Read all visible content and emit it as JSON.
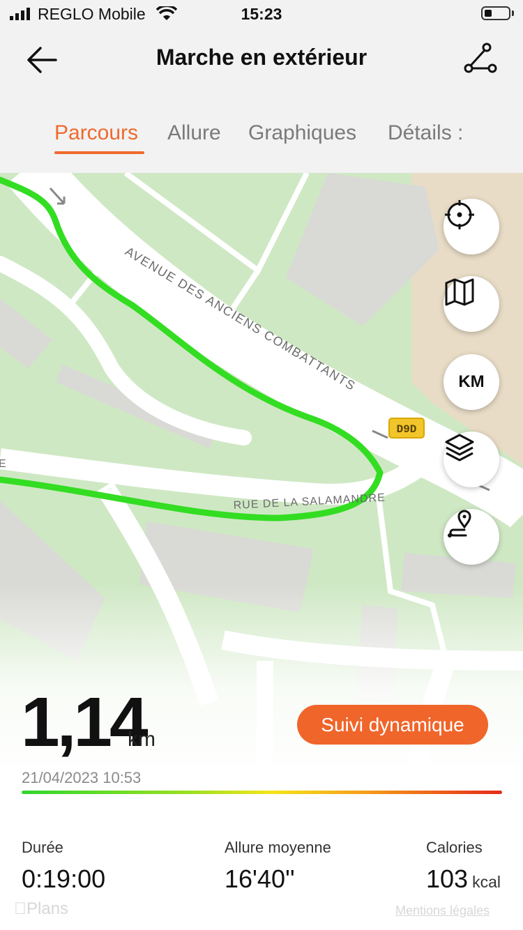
{
  "status_bar": {
    "carrier": "REGLO Mobile",
    "time": "15:23",
    "battery_level": 0.3
  },
  "nav": {
    "title": "Marche en extérieur",
    "back_icon": "arrow-left-icon",
    "route_icon": "route-share-icon"
  },
  "tabs": [
    {
      "label": "Parcours",
      "active": true
    },
    {
      "label": "Allure",
      "active": false
    },
    {
      "label": "Graphiques",
      "active": false
    },
    {
      "label": "Détails :",
      "active": false
    }
  ],
  "map": {
    "street_1": "AVENUE DES ANCIENS COMBATTANTS",
    "street_2": "RUE DE LA SALAMANDRE",
    "road_badge": "D9D",
    "route_color": "#33dd22",
    "map_attribution": "Plans",
    "legal_link": "Mentions légales",
    "buttons": [
      {
        "name": "locate-button",
        "icon": "crosshair-icon"
      },
      {
        "name": "map-type-button",
        "icon": "map-icon"
      },
      {
        "name": "unit-button",
        "label": "KM"
      },
      {
        "name": "layers-button",
        "icon": "layers-icon"
      },
      {
        "name": "route-pin-button",
        "icon": "route-pin-icon"
      }
    ]
  },
  "summary": {
    "distance": "1,14",
    "distance_unit": "km",
    "follow_button": "Suivi dynamique",
    "date": "21/04/2023 10:53",
    "stats": [
      {
        "label": "Durée",
        "value": "0:19:00",
        "unit": ""
      },
      {
        "label": "Allure moyenne",
        "value": "16'40''",
        "unit": ""
      },
      {
        "label": "Calories",
        "value": "103",
        "unit": "kcal"
      }
    ]
  },
  "colors": {
    "accent": "#ef6a2e",
    "button": "#f0652a",
    "map_green": "#cfe8c4"
  }
}
